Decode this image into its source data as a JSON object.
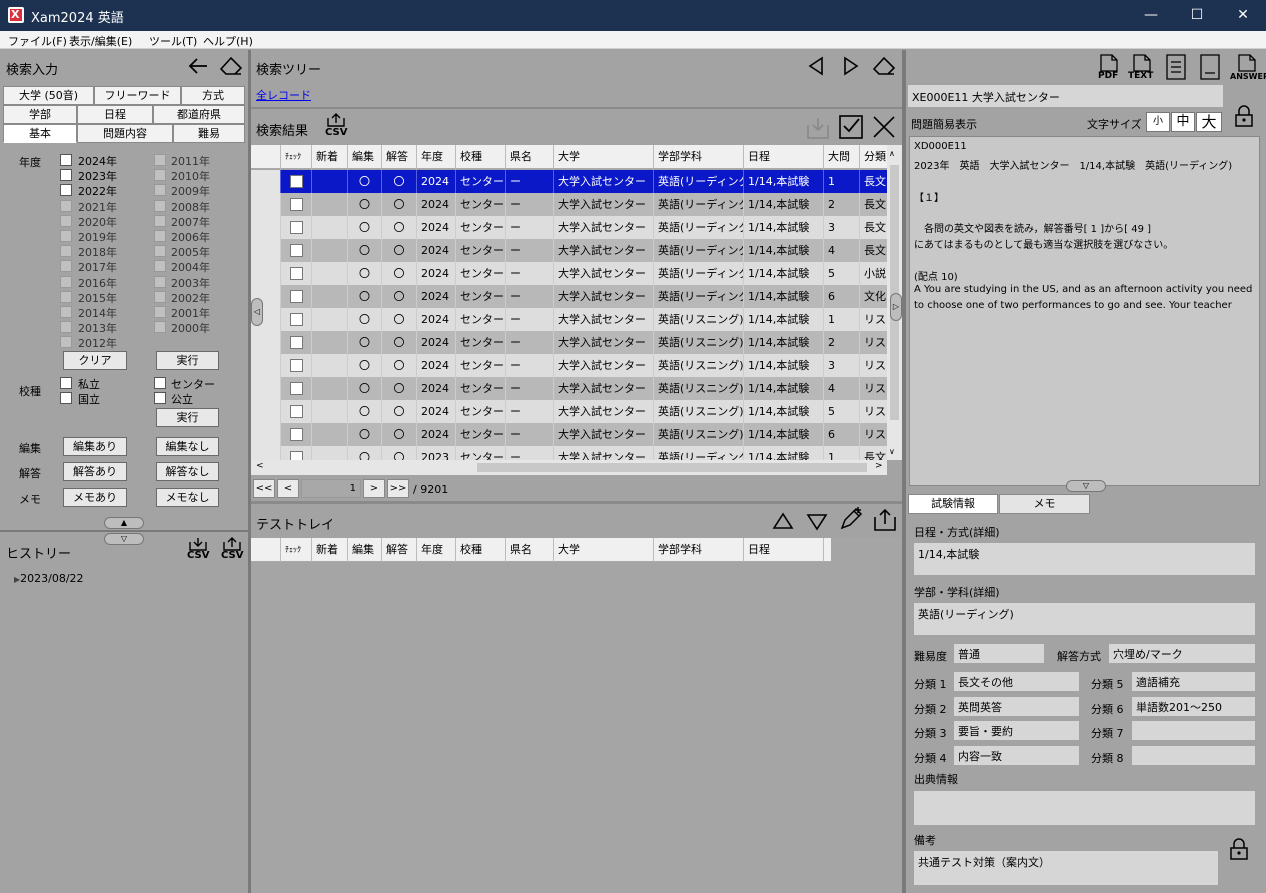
{
  "window": {
    "title": "Xam2024 英語",
    "app_icon_letter": "X"
  },
  "menu": [
    "ファイル(F)",
    "表示/編集(E)",
    "ツール(T)",
    "ヘルプ(H)"
  ],
  "left": {
    "title": "検索入力",
    "tabs_row1": [
      "大学 (50音)",
      "フリーワード",
      "方式"
    ],
    "tabs_row2": [
      "学部",
      "日程",
      "都道府県"
    ],
    "tabs_row3": [
      "基本",
      "問題内容",
      "難易"
    ],
    "year_label": "年度",
    "years_col1": [
      {
        "l": "2024年",
        "en": true
      },
      {
        "l": "2023年",
        "en": true
      },
      {
        "l": "2022年",
        "en": true
      },
      {
        "l": "2021年",
        "en": false
      },
      {
        "l": "2020年",
        "en": false
      },
      {
        "l": "2019年",
        "en": false
      },
      {
        "l": "2018年",
        "en": false
      },
      {
        "l": "2017年",
        "en": false
      },
      {
        "l": "2016年",
        "en": false
      },
      {
        "l": "2015年",
        "en": false
      },
      {
        "l": "2014年",
        "en": false
      },
      {
        "l": "2013年",
        "en": false
      },
      {
        "l": "2012年",
        "en": false
      }
    ],
    "years_col2": [
      "2011年",
      "2010年",
      "2009年",
      "2008年",
      "2007年",
      "2006年",
      "2005年",
      "2004年",
      "2003年",
      "2002年",
      "2001年",
      "2000年"
    ],
    "clear_label": "クリア",
    "run_label": "実行",
    "school_label": "校種",
    "school_opts": [
      "私立",
      "センター",
      "国立",
      "公立"
    ],
    "run2_label": "実行",
    "edit_label": "編集",
    "edit_yes": "編集あり",
    "edit_no": "編集なし",
    "answer_label": "解答",
    "answer_yes": "解答あり",
    "answer_no": "解答なし",
    "memo_label": "メモ",
    "memo_yes": "メモあり",
    "memo_no": "メモなし",
    "history_title": "ヒストリー",
    "csv": "CSV",
    "history_item": "2023/08/22"
  },
  "mid": {
    "tree_title": "検索ツリー",
    "all_records": "全レコード",
    "result_title": "検索結果",
    "csv": "CSV",
    "columns": [
      "ﾁｪｯｸ",
      "新着",
      "編集",
      "解答",
      "年度",
      "校種",
      "県名",
      "大学",
      "学部学科",
      "日程",
      "大問",
      "分類"
    ],
    "rows": [
      [
        "",
        "",
        "〇",
        "〇",
        "2024",
        "センター",
        "ー",
        "大学入試センター",
        "英語(リーディング)",
        "1/14,本試験",
        "1",
        "長文"
      ],
      [
        "",
        "",
        "〇",
        "〇",
        "2024",
        "センター",
        "ー",
        "大学入試センター",
        "英語(リーディング)",
        "1/14,本試験",
        "2",
        "長文"
      ],
      [
        "",
        "",
        "〇",
        "〇",
        "2024",
        "センター",
        "ー",
        "大学入試センター",
        "英語(リーディング)",
        "1/14,本試験",
        "3",
        "長文"
      ],
      [
        "",
        "",
        "〇",
        "〇",
        "2024",
        "センター",
        "ー",
        "大学入試センター",
        "英語(リーディング)",
        "1/14,本試験",
        "4",
        "長文"
      ],
      [
        "",
        "",
        "〇",
        "〇",
        "2024",
        "センター",
        "ー",
        "大学入試センター",
        "英語(リーディング)",
        "1/14,本試験",
        "5",
        "小説"
      ],
      [
        "",
        "",
        "〇",
        "〇",
        "2024",
        "センター",
        "ー",
        "大学入試センター",
        "英語(リーディング)",
        "1/14,本試験",
        "6",
        "文化"
      ],
      [
        "",
        "",
        "〇",
        "〇",
        "2024",
        "センター",
        "ー",
        "大学入試センター",
        "英語(リスニング)",
        "1/14,本試験",
        "1",
        "リス"
      ],
      [
        "",
        "",
        "〇",
        "〇",
        "2024",
        "センター",
        "ー",
        "大学入試センター",
        "英語(リスニング)",
        "1/14,本試験",
        "2",
        "リス"
      ],
      [
        "",
        "",
        "〇",
        "〇",
        "2024",
        "センター",
        "ー",
        "大学入試センター",
        "英語(リスニング)",
        "1/14,本試験",
        "3",
        "リス"
      ],
      [
        "",
        "",
        "〇",
        "〇",
        "2024",
        "センター",
        "ー",
        "大学入試センター",
        "英語(リスニング)",
        "1/14,本試験",
        "4",
        "リス"
      ],
      [
        "",
        "",
        "〇",
        "〇",
        "2024",
        "センター",
        "ー",
        "大学入試センター",
        "英語(リスニング)",
        "1/14,本試験",
        "5",
        "リス"
      ],
      [
        "",
        "",
        "〇",
        "〇",
        "2024",
        "センター",
        "ー",
        "大学入試センター",
        "英語(リスニング)",
        "1/14,本試験",
        "6",
        "リス"
      ],
      [
        "",
        "",
        "〇",
        "〇",
        "2023",
        "センター",
        "ー",
        "大学入試センター",
        "英語(リーディング)",
        "1/14,本試験",
        "1",
        "長文"
      ]
    ],
    "pager": {
      "first": "<<",
      "prev": "<",
      "page": "1",
      "next": ">",
      "last": ">>",
      "total": "/ 9201"
    },
    "tray_title": "テストトレイ",
    "tray_columns": [
      "ﾁｪｯｸ",
      "新着",
      "編集",
      "解答",
      "年度",
      "校種",
      "県名",
      "大学",
      "学部学科",
      "日程"
    ]
  },
  "right": {
    "icons": [
      "PDF",
      "TEXT",
      "",
      "",
      "ANSWER"
    ],
    "record_title": "XE000E11 大学入試センター",
    "simple_view": "問題簡易表示",
    "font_size_label": "文字サイズ",
    "font_sizes": [
      "小",
      "中",
      "大"
    ],
    "preview_lines": [
      "XD000E11",
      "2023年　英語　大学入試センター　1/14,本試験　英語(リーディング)",
      "",
      "【１】",
      "",
      "　各問の英文や図表を読み，解答番号[ 1 ]から[ 49 ]",
      "にあてはまるものとして最も適当な選択肢を選びなさい。",
      "",
      "(配点 10)",
      "A  You are studying in the US, and as an afternoon activity you need",
      "to choose one of two performances to go and see. Your teacher"
    ],
    "tabs": [
      "試験情報",
      "メモ"
    ],
    "schedule_label": "日程・方式(詳細)",
    "schedule_value": "1/14,本試験",
    "dept_label": "学部・学科(詳細)",
    "dept_value": "英語(リーディング)",
    "difficulty_label": "難易度",
    "difficulty_value": "普通",
    "answer_method_label": "解答方式",
    "answer_method_value": "穴埋め/マーク",
    "class_labels": [
      "分類 1",
      "分類 2",
      "分類 3",
      "分類 4",
      "分類 5",
      "分類 6",
      "分類 7",
      "分類 8"
    ],
    "class_values": [
      "長文その他",
      "英問英答",
      "要旨・要約",
      "内容一致",
      "適語補充",
      "単語数201〜250",
      "",
      ""
    ],
    "source_label": "出典情報",
    "source_value": "",
    "note_label": "備考",
    "note_value": "共通テスト対策（案内文）"
  }
}
